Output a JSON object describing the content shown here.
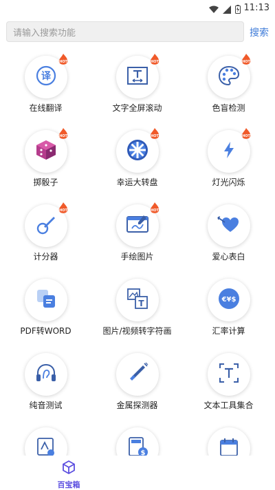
{
  "status_bar": {
    "time": "11:13",
    "icons": [
      "wifi-icon",
      "signal-icon",
      "battery-icon"
    ]
  },
  "search": {
    "placeholder": "请输入搜索功能",
    "button_label": "搜索"
  },
  "tools": [
    {
      "label": "在线翻译",
      "icon": "translate-icon",
      "hot": true
    },
    {
      "label": "文字全屏滚动",
      "icon": "text-scroll-icon",
      "hot": true
    },
    {
      "label": "色盲检测",
      "icon": "palette-icon",
      "hot": true
    },
    {
      "label": "掷骰子",
      "icon": "dice-icon",
      "hot": true
    },
    {
      "label": "幸运大转盘",
      "icon": "wheel-icon",
      "hot": true
    },
    {
      "label": "灯光闪烁",
      "icon": "flash-icon",
      "hot": true
    },
    {
      "label": "计分器",
      "icon": "score-icon",
      "hot": true
    },
    {
      "label": "手绘图片",
      "icon": "drawing-icon",
      "hot": true
    },
    {
      "label": "爱心表白",
      "icon": "heart-icon",
      "hot": false
    },
    {
      "label": "PDF转WORD",
      "icon": "pdf-word-icon",
      "hot": false
    },
    {
      "label": "图片/视频转字符画",
      "icon": "image-to-text-icon",
      "hot": false
    },
    {
      "label": "汇率计算",
      "icon": "currency-icon",
      "hot": false
    },
    {
      "label": "纯音测试",
      "icon": "hearing-test-icon",
      "hot": false
    },
    {
      "label": "金属探测器",
      "icon": "metal-detector-icon",
      "hot": false
    },
    {
      "label": "文本工具集合",
      "icon": "text-tools-icon",
      "hot": false
    },
    {
      "label": "",
      "icon": "image-edit-icon",
      "hot": false
    },
    {
      "label": "",
      "icon": "calculator-icon",
      "hot": false
    },
    {
      "label": "",
      "icon": "calendar-icon",
      "hot": false
    }
  ],
  "bottom_nav": {
    "items": [
      {
        "label": "百宝箱",
        "icon": "cube-icon",
        "active": true
      }
    ]
  },
  "colors": {
    "accent": "#3e7bd8",
    "icon": "#4a7fe0",
    "hot": "#f05a2a",
    "tab_active": "#5b4ee0"
  }
}
